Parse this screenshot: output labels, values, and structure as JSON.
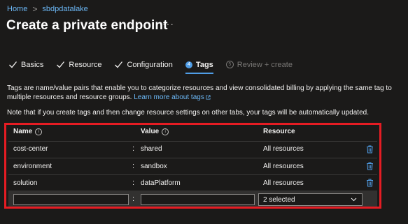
{
  "breadcrumb": {
    "home": "Home",
    "resource": "sbdpdatalake",
    "separator": ">"
  },
  "title": "Create a private endpoint",
  "more_label": "···",
  "tabs": [
    {
      "label": "Basics",
      "state": "done"
    },
    {
      "label": "Resource",
      "state": "done"
    },
    {
      "label": "Configuration",
      "state": "done"
    },
    {
      "number": "4",
      "label": "Tags",
      "state": "active"
    },
    {
      "number": "5",
      "label": "Review + create",
      "state": "disabled"
    }
  ],
  "description": {
    "line1": "Tags are name/value pairs that enable you to categorize resources and view consolidated billing by applying the same tag to multiple resources and resource groups. ",
    "learn_more": "Learn more about tags",
    "line2": "Note that if you create tags and then change resource settings on other tabs, your tags will be automatically updated."
  },
  "table": {
    "headers": {
      "name": "Name",
      "value": "Value",
      "resource": "Resource"
    },
    "colon": ":",
    "rows": [
      {
        "name": "cost-center",
        "value": "shared",
        "resource": "All resources"
      },
      {
        "name": "environment",
        "value": "sandbox",
        "resource": "All resources"
      },
      {
        "name": "solution",
        "value": "dataPlatform",
        "resource": "All resources"
      }
    ],
    "new_row": {
      "name": "",
      "value": "",
      "resource": "2 selected"
    }
  },
  "colors": {
    "accent": "#4f9de6",
    "link": "#6cb8f6",
    "highlight_border": "#e51c23",
    "background": "#1b1a19"
  },
  "icons": {
    "check": "check-icon",
    "info": "info-icon",
    "delete": "trash-icon",
    "dropdown": "chevron-down-icon",
    "external": "external-link-icon"
  }
}
